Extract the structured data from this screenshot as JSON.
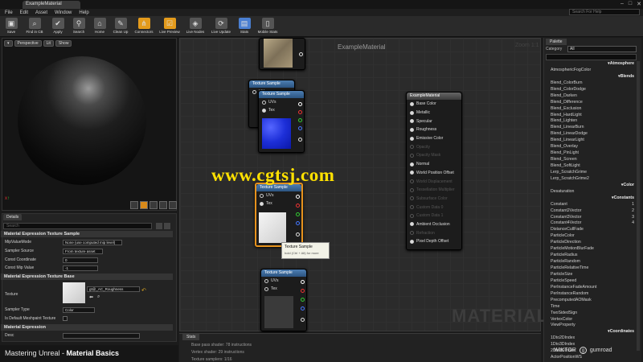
{
  "window": {
    "tab_title": "ExampleMaterial",
    "search_help_placeholder": "Search For Help"
  },
  "menu": [
    "File",
    "Edit",
    "Asset",
    "Window",
    "Help"
  ],
  "toolbar": [
    {
      "label": "Save",
      "icon": "save-icon",
      "glyph": "▣"
    },
    {
      "label": "Find in CB",
      "icon": "search-icon",
      "glyph": "⌕"
    },
    {
      "label": "Apply",
      "icon": "check-icon",
      "glyph": "✔"
    },
    {
      "label": "Search",
      "icon": "binoculars-icon",
      "glyph": "⚲"
    },
    {
      "label": "Home",
      "icon": "home-icon",
      "glyph": "⌂"
    },
    {
      "label": "Clean Up",
      "icon": "broom-icon",
      "glyph": "✎"
    },
    {
      "label": "Connectors",
      "icon": "connectors-icon",
      "glyph": "⋔",
      "state": "active"
    },
    {
      "label": "Live Preview",
      "icon": "live-preview-icon",
      "glyph": "☑",
      "state": "active"
    },
    {
      "label": "Live Nodes",
      "icon": "live-nodes-icon",
      "glyph": "◈"
    },
    {
      "label": "Live Update",
      "icon": "live-update-icon",
      "glyph": "⟳"
    },
    {
      "label": "Stats",
      "icon": "stats-icon",
      "glyph": "▤",
      "state": "blue"
    },
    {
      "label": "Mobile Stats",
      "icon": "mobile-stats-icon",
      "glyph": "▯"
    }
  ],
  "viewport": {
    "buttons": [
      "Perspective",
      "Lit",
      "Show"
    ]
  },
  "details": {
    "tab": "Details",
    "search_placeholder": "Search",
    "section1": "Material Expression Texture Sample",
    "mip_value_mode_label": "MipValueMode",
    "mip_value_mode_value": "None (use computed mip level)",
    "sampler_source_label": "Sampler Source",
    "sampler_source_value": "From texture asset",
    "const_coordinate_label": "Const Coordinate",
    "const_coordinate_value": "0",
    "const_mip_label": "Const Mip Value",
    "const_mip_value": "-1",
    "section2": "Material Expression Texture Base",
    "texture_label": "Texture",
    "texture_value": "gt@_AC_Roughness",
    "sampler_type_label": "Sampler Type",
    "sampler_type_value": "Color",
    "is_default_label": "Is Default Meshpaint Texture",
    "section3": "Material Expression",
    "desc_label": "Desc"
  },
  "course": {
    "prefix": "Mastering Unreal - ",
    "title": "Material Basics"
  },
  "graph": {
    "title": "ExampleMaterial",
    "zoom": "Zoom 1:1",
    "watermark": "MATERIAL",
    "texture_node_title": "Texture Sample",
    "pin_uvs": "UVs",
    "pin_tex": "Tex",
    "tooltip_title": "Texture Sample",
    "tooltip_sub": "hold (Ctrl + Alt) for more",
    "material_node": {
      "title": "ExampleMaterial",
      "inputs": [
        {
          "label": "Base Color",
          "active": true
        },
        {
          "label": "Metallic",
          "active": true
        },
        {
          "label": "Specular",
          "active": true
        },
        {
          "label": "Roughness",
          "active": true
        },
        {
          "label": "Emissive Color",
          "active": true
        },
        {
          "label": "Opacity",
          "active": false
        },
        {
          "label": "Opacity Mask",
          "active": false
        },
        {
          "label": "Normal",
          "active": true
        },
        {
          "label": "World Position Offset",
          "active": true
        },
        {
          "label": "World Displacement",
          "active": false
        },
        {
          "label": "Tessellation Multiplier",
          "active": false
        },
        {
          "label": "Subsurface Color",
          "active": false
        },
        {
          "label": "Custom Data 0",
          "active": false
        },
        {
          "label": "Custom Data 1",
          "active": false
        },
        {
          "label": "Ambient Occlusion",
          "active": true
        },
        {
          "label": "Refraction",
          "active": false
        },
        {
          "label": "Pixel Depth Offset",
          "active": true
        }
      ]
    }
  },
  "overlay_url": "www.cgtsj.com",
  "stats": {
    "tab": "Stats",
    "lines": [
      "Base pass shader: 78 instructions",
      "Vertex shader: 29 instructions",
      "Texture samplers: 1/16"
    ]
  },
  "palette": {
    "tab": "Palette",
    "category_label": "Category",
    "category_value": "All",
    "items": [
      {
        "t": "Atmosphere",
        "cat": true
      },
      {
        "t": "AtmosphericFogColor"
      },
      {
        "t": "Blends",
        "cat": true
      },
      {
        "t": "Blend_ColorBurn"
      },
      {
        "t": "Blend_ColorDodge"
      },
      {
        "t": "Blend_Darken"
      },
      {
        "t": "Blend_Difference"
      },
      {
        "t": "Blend_Exclusion"
      },
      {
        "t": "Blend_HardLight"
      },
      {
        "t": "Blend_Lighten"
      },
      {
        "t": "Blend_LinearBurn"
      },
      {
        "t": "Blend_LinearDodge"
      },
      {
        "t": "Blend_LinearLight"
      },
      {
        "t": "Blend_Overlay"
      },
      {
        "t": "Blend_PinLight"
      },
      {
        "t": "Blend_Screen"
      },
      {
        "t": "Blend_SoftLight"
      },
      {
        "t": "Lerp_ScratchGrime"
      },
      {
        "t": "Lerp_ScratchGrime2"
      },
      {
        "t": "Color",
        "cat": true
      },
      {
        "t": "Desaturation"
      },
      {
        "t": "Constants",
        "cat": true
      },
      {
        "t": "Constant",
        "k": "1"
      },
      {
        "t": "Constant2Vector",
        "k": "2"
      },
      {
        "t": "Constant3Vector",
        "k": "3"
      },
      {
        "t": "Constant4Vector",
        "k": "4"
      },
      {
        "t": "DistanceCullFade"
      },
      {
        "t": "ParticleColor"
      },
      {
        "t": "ParticleDirection"
      },
      {
        "t": "ParticleMotionBlurFade"
      },
      {
        "t": "ParticleRadius"
      },
      {
        "t": "ParticleRandom"
      },
      {
        "t": "ParticleRelativeTime"
      },
      {
        "t": "ParticleSize"
      },
      {
        "t": "ParticleSpeed"
      },
      {
        "t": "PerInstanceFadeAmount"
      },
      {
        "t": "PerInstanceRandom"
      },
      {
        "t": "PrecomputedAOMask"
      },
      {
        "t": "Time"
      },
      {
        "t": "TwoSidedSign"
      },
      {
        "t": "VertexColor"
      },
      {
        "t": "ViewProperty"
      },
      {
        "t": "Coordinates",
        "cat": true
      },
      {
        "t": "1Dto2DIndex"
      },
      {
        "t": "1Dto3DIndex"
      },
      {
        "t": "2Dto1DIndex"
      },
      {
        "t": "ActorPositionWS"
      }
    ]
  },
  "brand": {
    "left": "WIKTOR",
    "right": "gumroad",
    "logo_letter": "g"
  }
}
